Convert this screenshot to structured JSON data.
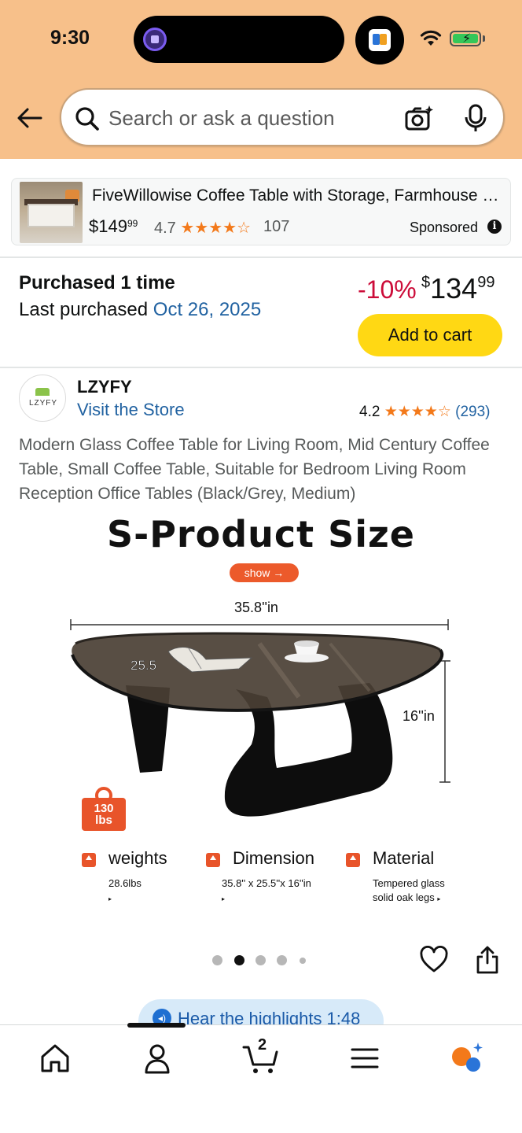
{
  "status_bar": {
    "time": "9:30"
  },
  "search": {
    "placeholder": "Search or ask a question"
  },
  "sponsored": {
    "title": "FiveWillowise Coffee Table with Storage, Farmhouse Li...",
    "price_dollars": "$149",
    "price_cents": "99",
    "rating": "4.7",
    "stars": "★★★★☆",
    "review_count": "107",
    "label": "Sponsored"
  },
  "purchase": {
    "title": "Purchased 1 time",
    "last_label": "Last purchased ",
    "last_date": "Oct 26, 2025",
    "discount": "-10%",
    "price_currency": "$",
    "price_whole": "134",
    "price_cents": "99",
    "add_to_cart": "Add to cart"
  },
  "store": {
    "logo_text": "LZYFY",
    "brand": "LZYFY",
    "visit_label": "Visit the Store",
    "rating": "4.2",
    "stars": "★★★★☆",
    "rating_count": "(293)"
  },
  "product": {
    "title": "Modern Glass Coffee Table for Living Room, Mid Century Coffee Table, Small Coffee Table, Suitable for Bedroom Living Room Reception Office Tables (Black/Grey, Medium)"
  },
  "gallery": {
    "heading": "S-Product  Size",
    "show_label": "show →",
    "width_label": "35.8''in",
    "height_label": "16''in",
    "depth_label": "25.5",
    "badge_value": "130",
    "badge_unit": "lbs",
    "features": [
      {
        "title": "weights",
        "line1": "28.6lbs",
        "line2": ""
      },
      {
        "title": "Dimension",
        "line1": "35.8'' x 25.5''x 16''in",
        "line2": ""
      },
      {
        "title": "Material",
        "line1": "Tempered glass",
        "line2": "solid oak legs"
      }
    ],
    "dot_count": 5,
    "active_dot": 1
  },
  "highlights": {
    "label": "Hear the highlights 1:48"
  },
  "nav": {
    "cart_count": "2"
  },
  "colors": {
    "header_bg": "#f7c08a",
    "link_blue": "#2162a1",
    "deal_red": "#cc0c39",
    "cart_yellow": "#ffd814",
    "star_orange": "#f3791a",
    "accent_orange": "#e8542a"
  }
}
